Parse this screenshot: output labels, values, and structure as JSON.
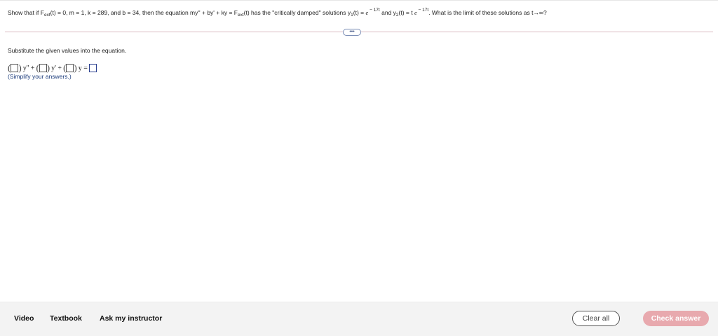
{
  "question": {
    "p1": "Show that if F",
    "sub_ext1": "ext",
    "p2": "(t) = 0, m = 1, k = 289, and b = 34, then the equation my'' + by' + ky = F",
    "sub_ext2": "ext",
    "p3": "(t) has the \"critically damped\" solutions y",
    "sub_1": "1",
    "p4": "(t) = ",
    "e1": "e",
    "exp1": " − 17t",
    "p5": " and y",
    "sub_2": "2",
    "p6": "(t) = t ",
    "e2": "e",
    "exp2": " − 17t",
    "p7": ". What is the limit of these solutions as t→∞?"
  },
  "more_button": "•••",
  "step": {
    "instruction": "Substitute the given values into the equation.",
    "term_ypp": "y'' +",
    "term_yp": "y' +",
    "term_y": "y =",
    "hint": "(Simplify your answers.)"
  },
  "footer": {
    "video": "Video",
    "textbook": "Textbook",
    "ask": "Ask my instructor",
    "clear": "Clear all",
    "check": "Check answer"
  },
  "colors": {
    "check_button": "#e8a9ae",
    "hint_text": "#1a3a7a",
    "divider": "#d9b9c0"
  }
}
